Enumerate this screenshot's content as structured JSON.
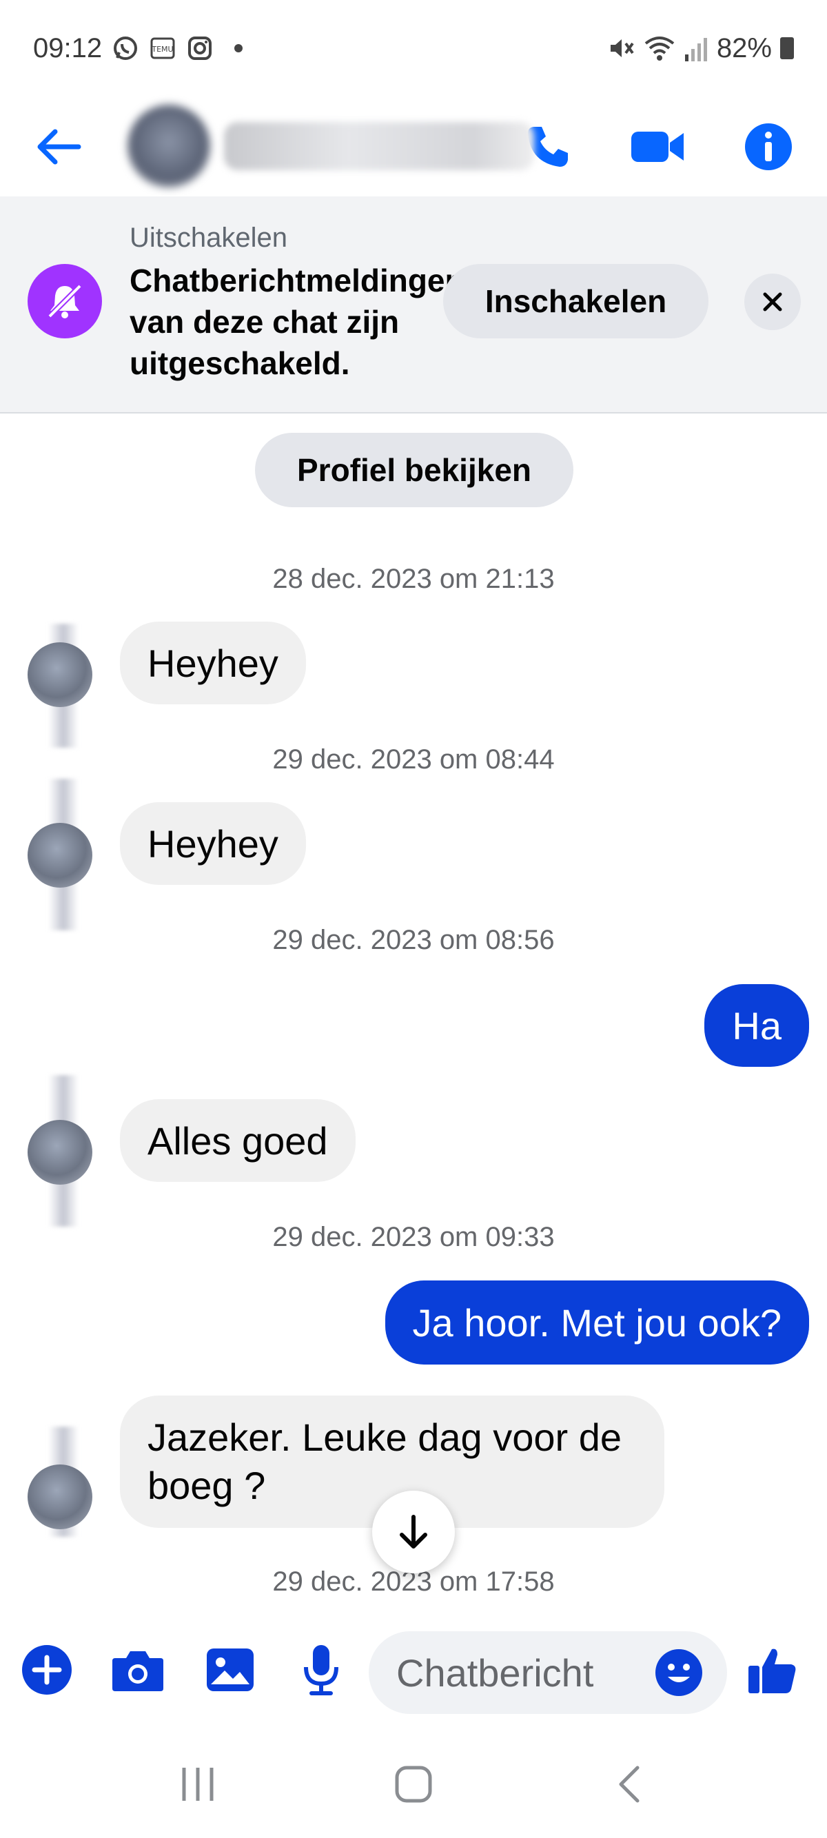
{
  "status_bar": {
    "time": "09:12",
    "battery": "82%",
    "icons": [
      "whatsapp-icon",
      "temu-icon",
      "instagram-icon",
      "mute-icon",
      "wifi-icon",
      "signal-icon",
      "battery-icon"
    ]
  },
  "header": {
    "icons": [
      "back-arrow-icon",
      "phone-icon",
      "video-camera-icon",
      "info-icon"
    ],
    "accent_color": "#0866ff"
  },
  "banner": {
    "title": "Uitschakelen",
    "text": "Chatberichtmeldingen van deze chat zijn uitgeschakeld.",
    "button": "Inschakelen",
    "icon_color": "#a033ff"
  },
  "conversation": {
    "profile_button": "Profiel bekijken",
    "timestamps": [
      "28 dec. 2023 om 21:13",
      "29 dec. 2023 om 08:44",
      "29 dec. 2023 om 08:56",
      "29 dec. 2023 om 09:33",
      "29 dec. 2023 om 17:58"
    ],
    "messages": [
      {
        "sender": "other",
        "text": "Heyhey"
      },
      {
        "sender": "other",
        "text": "Heyhey"
      },
      {
        "sender": "me",
        "text": "Ha"
      },
      {
        "sender": "other",
        "text": "Alles goed"
      },
      {
        "sender": "me",
        "text": "Ja hoor. Met jou ook?"
      },
      {
        "sender": "other",
        "text": "Jazeker. Leuke dag voor de boeg ?"
      }
    ],
    "outgoing_color": "#0a3fd9"
  },
  "composer": {
    "placeholder": "Chatbericht",
    "icons": [
      "plus-icon",
      "camera-icon",
      "gallery-icon",
      "microphone-icon",
      "emoji-icon",
      "thumbs-up-icon"
    ],
    "icon_color": "#0a3fd9"
  }
}
